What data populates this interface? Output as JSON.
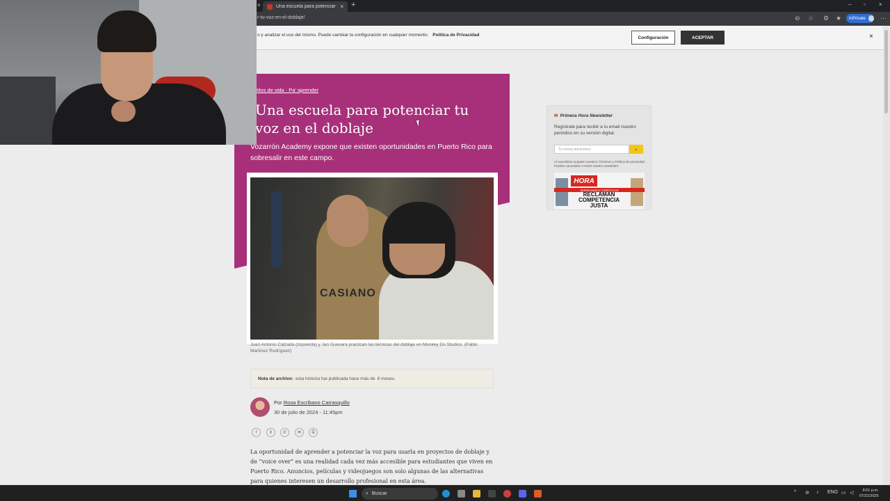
{
  "browser": {
    "tab_title": "Una escuela para potenciar tu voz",
    "url": "r-tu-voz-en-el-doblaje/",
    "inprivate_label": "InPrivate"
  },
  "cookie_banner": {
    "text": "o y analizar el uso del mismo. Puede cambiar la configuración en cualquier momento.",
    "policy_link": "Política de Privacidad",
    "config_label": "Configuración",
    "accept_label": "ACEPTAR",
    "close_icon": "×"
  },
  "article": {
    "breadcrumb": "tilos de vida · Pa' aprender",
    "title": "Una escuela para potenciar tu voz en el doblaje",
    "subtitle": "Vozarrón Academy expone que existen oportunidades en Puerto Rico para sobresalir en este campo.",
    "photo_shirt_text": "CASIANO",
    "caption": "Juan Antonio Calzada (izquierda) y Jan Guevara practican las técnicas del doblaje en Monkey Do Studios. (Pablo Martínez Rodríguez)",
    "note_label": "Nota de archivo:",
    "note_text": "esta historia fue publicada hace más de",
    "note_period": "6 meses.",
    "by_prefix": "Por",
    "author": "Rosa Escribano Carrasquillo",
    "date": "30 de julio de 2024 - 11:45pm",
    "share_icons": [
      "facebook-icon",
      "x-icon",
      "whatsapp-icon",
      "email-icon",
      "print-icon"
    ],
    "share_glyphs": [
      "f",
      "X",
      "✆",
      "✉",
      "⎙"
    ],
    "body": "La oportunidad de aprender a potenciar la voz para usarla en proyectos de doblaje y de “voice over” es una realidad cada vez más accesible para estudiantes que viven en Puerto Rico. Anuncios, películas y videojuegos son solo algunas de las alternativas para quienes interesen un desarrollo profesional en esta área."
  },
  "newsletter": {
    "title": "Primera Hora Newsletter",
    "icon": "✉",
    "description": "Regístrate para recibir a tu email nuestro periódico en su versión digital.",
    "email_placeholder": "Tu correo electrónico",
    "submit_glyph": "›",
    "legal": "Al suscribirse aceptas nuestros Términos y Política de privacidad. Puedes cancelarla o recibir nuestro newsletter.",
    "cover_logo": "HORA",
    "cover_strip": "EMPRESARIOS TURÍSTICOS",
    "cover_headline": "RECLAMAN COMPETENCIA JUSTA"
  },
  "taskbar": {
    "search_label": "Buscar",
    "lang": "ENG",
    "time": "8:01 p.m.",
    "date": "07/21/2025"
  },
  "colors": {
    "hero": "#a8307a",
    "accent_yellow": "#f2c618",
    "brand_red": "#d8271f"
  }
}
